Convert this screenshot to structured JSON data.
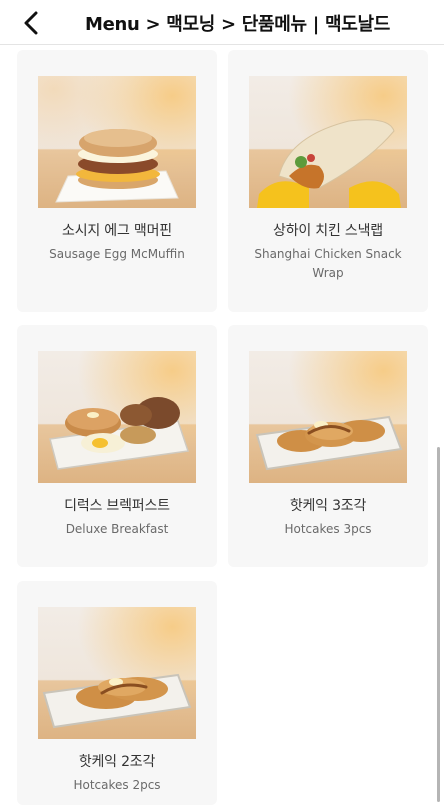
{
  "header": {
    "title": "Menu > 맥모닝 > 단품메뉴 | 맥도날드",
    "back_icon": "chevron-left-icon"
  },
  "items": [
    {
      "name_ko": "소시지 에그 맥머핀",
      "name_en": "Sausage Egg McMuffin"
    },
    {
      "name_ko": "상하이 치킨 스낵랩",
      "name_en": "Shanghai Chicken Snack Wrap"
    },
    {
      "name_ko": "디럭스 브렉퍼스트",
      "name_en": "Deluxe Breakfast"
    },
    {
      "name_ko": "핫케익 3조각",
      "name_en": "Hotcakes 3pcs"
    },
    {
      "name_ko": "핫케익 2조각",
      "name_en": "Hotcakes 2pcs"
    }
  ]
}
